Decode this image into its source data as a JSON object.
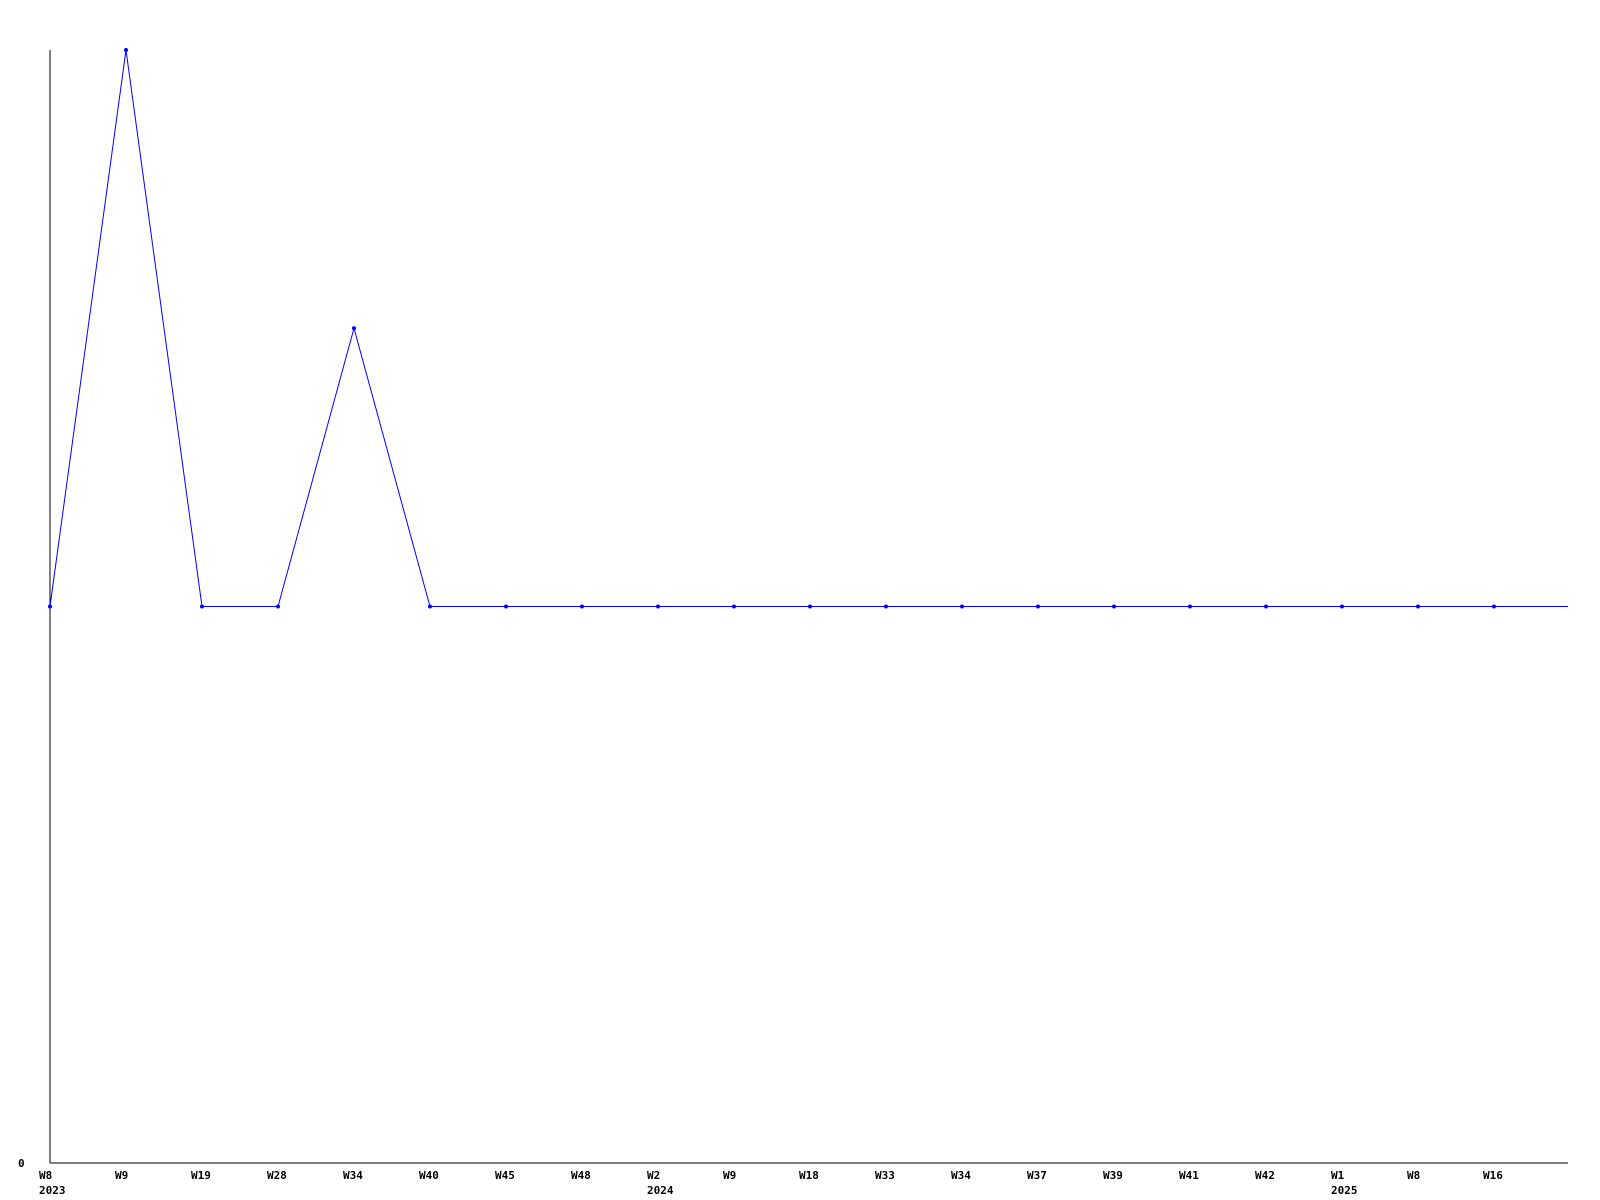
{
  "chart_data": {
    "type": "line",
    "title": "",
    "xlabel": "",
    "ylabel": "",
    "categories": [
      {
        "week": "W8",
        "year": "2023"
      },
      {
        "week": "W9",
        "year": ""
      },
      {
        "week": "W19",
        "year": ""
      },
      {
        "week": "W28",
        "year": ""
      },
      {
        "week": "W34",
        "year": ""
      },
      {
        "week": "W40",
        "year": ""
      },
      {
        "week": "W45",
        "year": ""
      },
      {
        "week": "W48",
        "year": ""
      },
      {
        "week": "W2",
        "year": "2024"
      },
      {
        "week": "W9",
        "year": ""
      },
      {
        "week": "W18",
        "year": ""
      },
      {
        "week": "W33",
        "year": ""
      },
      {
        "week": "W34",
        "year": ""
      },
      {
        "week": "W37",
        "year": ""
      },
      {
        "week": "W39",
        "year": ""
      },
      {
        "week": "W41",
        "year": ""
      },
      {
        "week": "W42",
        "year": ""
      },
      {
        "week": "W1",
        "year": "2025"
      },
      {
        "week": "W8",
        "year": ""
      },
      {
        "week": "W16",
        "year": ""
      }
    ],
    "series": [
      {
        "values": [
          1,
          2,
          1,
          1,
          1.5,
          1,
          1,
          1,
          1,
          1,
          1,
          1,
          1,
          1,
          1,
          1,
          1,
          1,
          1,
          1
        ]
      }
    ],
    "ylim": [
      0,
      2
    ],
    "yticks": [
      {
        "value": 0,
        "label": "0"
      }
    ],
    "grid": false,
    "legend": "none",
    "colors": {
      "line": "#0000ff",
      "axis": "#000000",
      "text": "#000000",
      "background": "#ffffff"
    }
  }
}
